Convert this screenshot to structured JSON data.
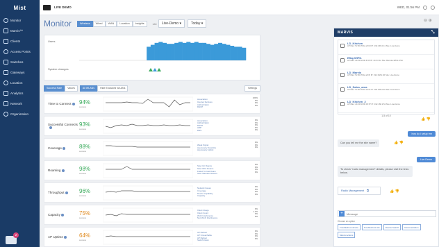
{
  "sidebar": {
    "logo": "Mist",
    "items": [
      {
        "label": "Monitor",
        "icon": "monitor-icon"
      },
      {
        "label": "Marvis™",
        "icon": "marvis-icon"
      },
      {
        "label": "Clients",
        "icon": "clients-icon"
      },
      {
        "label": "Access Points",
        "icon": "access-point-icon"
      },
      {
        "label": "Switches",
        "icon": "switch-icon"
      },
      {
        "label": "Gateways",
        "icon": "gateway-icon"
      },
      {
        "label": "Location",
        "icon": "location-icon"
      },
      {
        "label": "Analytics",
        "icon": "analytics-icon"
      },
      {
        "label": "Network",
        "icon": "network-icon"
      },
      {
        "label": "Organization",
        "icon": "organization-icon"
      }
    ],
    "badge": "2"
  },
  "topbar": {
    "org": "LIVE DEMO",
    "datetime": "WED, 01:56 PM"
  },
  "header": {
    "title": "Monitor",
    "tabs": [
      "Wireless",
      "Wired",
      "WAN",
      "Location",
      "Insights"
    ],
    "site_label": "site",
    "site_value": "Live-Demo ▾",
    "range_value": "Today ▾"
  },
  "overview": {
    "users_label": "Users",
    "system_label": "System changes",
    "bars": [
      0,
      0,
      0,
      0,
      0,
      0,
      0,
      0,
      0,
      0,
      0,
      0,
      0,
      0,
      0,
      0,
      0,
      14,
      16,
      18,
      19,
      18,
      17,
      17,
      18,
      19,
      18,
      19,
      18,
      19,
      18,
      18,
      17,
      16,
      17,
      18,
      17,
      16,
      15,
      14,
      14,
      13
    ]
  },
  "filters": {
    "success_rate": "Success Rate",
    "values": "Values",
    "all_wlans": "All WLANs",
    "hide_excluded": "Hide Excluded WLANs",
    "settings": "Settings"
  },
  "metrics": [
    {
      "name": "Time to Connect",
      "pct": "94%",
      "sub": "success",
      "color": "#3aaa5c",
      "reasons": [
        "Association",
        "Internet Services",
        "Authorization",
        "DHCP"
      ],
      "values": [
        "100%",
        "0%",
        "0%",
        "0%"
      ],
      "line": [
        7,
        7,
        7,
        7,
        6,
        7,
        7,
        8,
        2,
        7,
        7,
        7,
        13,
        3,
        10,
        7,
        7
      ]
    },
    {
      "name": "Successful Connects",
      "pct": "93%",
      "sub": "success",
      "color": "#3aaa5c",
      "reasons": [
        "Association",
        "Authorization",
        "DHCP",
        "ARP",
        "DNS"
      ],
      "values": [
        "0%",
        "0%",
        "0%",
        "0%",
        "0%"
      ],
      "line": [
        9,
        11,
        8,
        7,
        8,
        6,
        8,
        8,
        7,
        8,
        8,
        7,
        8,
        8,
        7,
        8,
        8
      ]
    },
    {
      "name": "Coverage",
      "pct": "88%",
      "sub": "success",
      "color": "#3aaa5c",
      "reasons": [
        "Weak Signal",
        "Asymmetry Downlink",
        "Asymmetry Uplink"
      ],
      "values": [
        "0%",
        "0%",
        "0%"
      ],
      "line": [
        5,
        5,
        6,
        6,
        6,
        6,
        7,
        7,
        7,
        7,
        7,
        7,
        7,
        7,
        7,
        7,
        7
      ]
    },
    {
      "name": "Roaming",
      "pct": "98%",
      "sub": "success",
      "color": "#3aaa5c",
      "reasons": [
        "Slow 11r Roams",
        "Slow OKC Roams",
        "Failed To Fast Roam",
        "Slow Standard Roams"
      ],
      "values": [
        "0%",
        "0%",
        "0%",
        "0%"
      ],
      "line": [
        7,
        7,
        7,
        7,
        3,
        7,
        7,
        7,
        7,
        7,
        7,
        7,
        7,
        7,
        7,
        7,
        7
      ]
    },
    {
      "name": "Throughput",
      "pct": "96%",
      "sub": "success",
      "color": "#3aaa5c",
      "reasons": [
        "Network Issues",
        "Coverage",
        "Device Capability",
        "Capacity"
      ],
      "values": [
        "0%",
        "0%",
        "0%",
        "0%"
      ],
      "line": [
        8,
        7,
        8,
        6,
        6,
        6,
        7,
        7,
        7,
        7,
        7,
        7,
        7,
        7,
        7,
        7,
        7
      ]
    },
    {
      "name": "Capacity",
      "pct": "75%",
      "sub": "success",
      "color": "#e08a1e",
      "reasons": [
        "Client Usage",
        "Client Count",
        "Wi-Fi Interference",
        "Non-Wi-Fi Interference"
      ],
      "values": [
        "0%",
        "1.3%",
        "0%",
        "0%"
      ],
      "line": [
        9,
        8,
        10,
        7,
        8,
        8,
        8,
        8,
        8,
        8,
        8,
        8,
        8,
        8,
        8,
        8,
        8
      ]
    },
    {
      "name": "AP Uptime",
      "pct": "64%",
      "sub": "success",
      "color": "#e08a1e",
      "reasons": [
        "AP Reboot",
        "AP Unreachable",
        "AP Reboot",
        "Switch Down"
      ],
      "values": [
        "0%",
        "0%",
        "0%",
        "0%"
      ],
      "line": [
        8,
        7,
        8,
        8,
        8,
        8,
        8,
        8,
        8,
        8,
        8,
        8,
        8,
        8,
        8,
        8,
        8
      ]
    }
  ],
  "marvis": {
    "title": "MARVIS",
    "results": [
      {
        "name": "LD_Kitchen",
        "detail": "AP Mac: 5c:5b:35:0e:e5:b3 IP: 192.168.2.41 Site: Live-Demo"
      },
      {
        "name": "Eftaj-WIFI1",
        "detail": "AP Mac: d4:20:b0:00:f0:0f IP: 10.0.0.12 Site: Remote-WFH-USA"
      },
      {
        "name": "LD_Marvis",
        "detail": "AP Mac: 5c:5b:35:0e:e5:0f IP: 192.168.2.40 Site: Live-Demo"
      },
      {
        "name": "LD_Sales_area",
        "detail": "AP Mac: 5c:5b:35:0e:e5:0c IP: 192.168.2.46 Site: Live-Demo"
      },
      {
        "name": "LD_Kitchen_2",
        "detail": "AP Mac: d4:20:b0:00:45:57 IP: 192.168.2.52 Site: Live-Demo"
      }
    ],
    "pager": "1-5 of 10",
    "user_msg_1": "how do i setup rrm",
    "bot_msg_1": "Can you tell me the site name?",
    "user_msg_2": "Live Demo",
    "bot_msg_2": "To check \"radio management\" details, please visit the links below.",
    "link": "Radio Management",
    "input_placeholder": "Message",
    "choose": "Choose an option",
    "options": [
      "Troubleshoot device",
      "Troubleshoot site",
      "Device Search",
      "Documentation",
      "Marvis Actions"
    ]
  }
}
